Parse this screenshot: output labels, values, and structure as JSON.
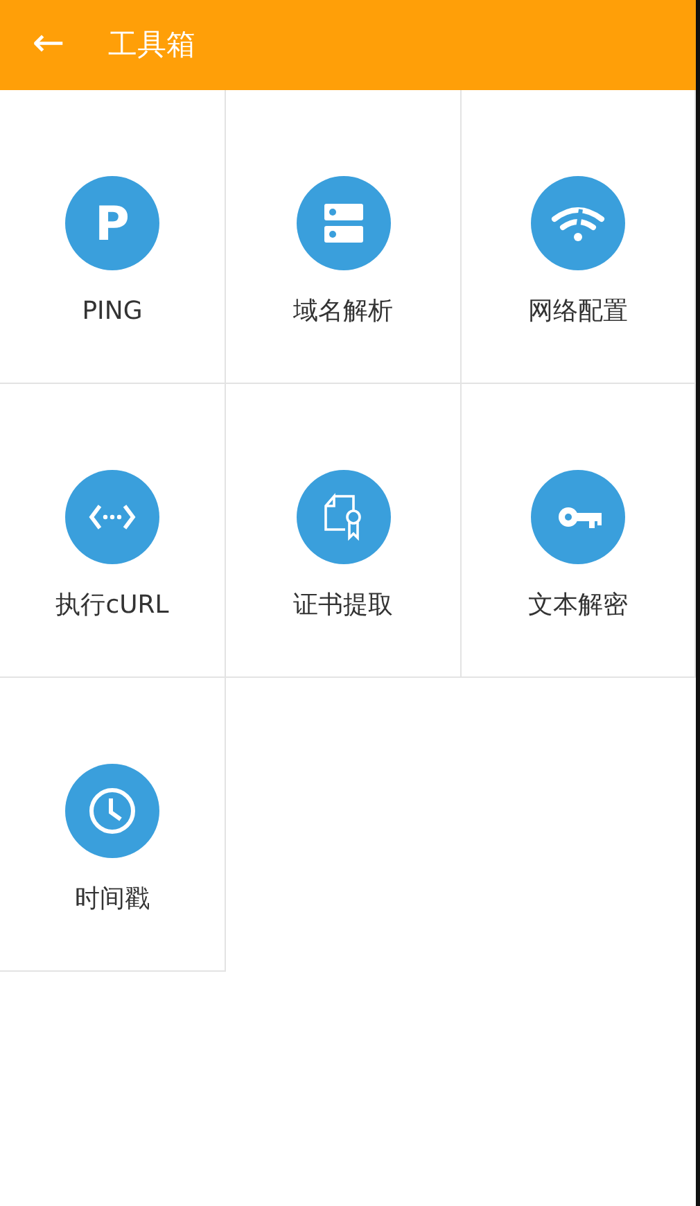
{
  "app_bar": {
    "back": "←",
    "title": "工具箱"
  },
  "tools": [
    {
      "label": "PING",
      "glyph": "P"
    },
    {
      "label": "域名解析"
    },
    {
      "label": "网络配置"
    },
    {
      "label": "执行cURL"
    },
    {
      "label": "证书提取"
    },
    {
      "label": "文本解密"
    },
    {
      "label": "时间戳"
    }
  ]
}
